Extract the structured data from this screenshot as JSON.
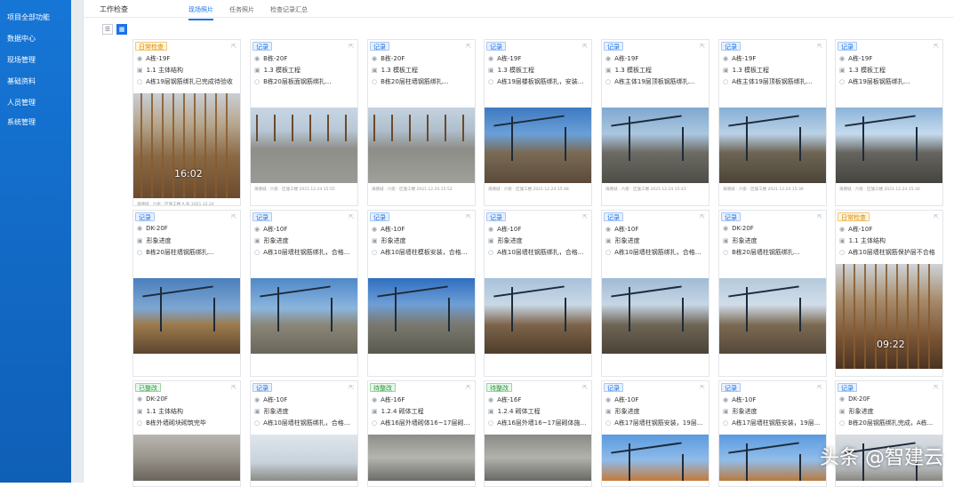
{
  "sidebar": {
    "items": [
      "项目全部功能",
      "数据中心",
      "现场管理",
      "基础资料",
      "人员管理",
      "系统管理"
    ]
  },
  "header": {
    "title": "工作检查",
    "tabs": [
      "现场照片",
      "任务照片",
      "检查记录汇总"
    ]
  },
  "view_toggle": {
    "list_icon": "list-icon",
    "grid_icon": "grid-icon",
    "active": "grid"
  },
  "watermark": "头条 @智建云",
  "cards": [
    {
      "tag": "日常检查",
      "tag_type": "ins",
      "location": "A栋-19F",
      "category": "1.1 主体结构",
      "note": "A栋19层钢筋绑扎已完成待验收",
      "caption": "海德城 · 六街 · 区施工楼 A 栋  2021.12.24",
      "timestamp": "16:02",
      "photo": "rebar"
    },
    {
      "tag": "记录",
      "tag_type": "rec",
      "location": "B栋-20F",
      "category": "1.3 模板工程",
      "note": "B栋20层板面钢筋绑扎...",
      "caption": "海德城 · 六街 · 区施工楼  2021.12.24 15:55",
      "timestamp": "",
      "photo": "deck"
    },
    {
      "tag": "记录",
      "tag_type": "rec",
      "location": "B栋-20F",
      "category": "1.3 模板工程",
      "note": "B栋20层柱墙钢筋绑扎...",
      "caption": "海德城 · 六街 · 区施工楼  2021.12.24 15:52",
      "timestamp": "",
      "photo": "deck2"
    },
    {
      "tag": "记录",
      "tag_type": "rec",
      "location": "A栋-19F",
      "category": "1.3 模板工程",
      "note": "A栋19层楼板钢筋绑扎，安装...",
      "caption": "海德城 · 六街 · 区施工楼  2021.12.24 15:48",
      "timestamp": "",
      "photo": "crane"
    },
    {
      "tag": "记录",
      "tag_type": "rec",
      "location": "A栋-19F",
      "category": "1.3 模板工程",
      "note": "A栋主体19层顶板钢筋绑扎...",
      "caption": "海德城 · 六街 · 区施工楼  2021.12.24 15:41",
      "timestamp": "",
      "photo": "crane2"
    },
    {
      "tag": "记录",
      "tag_type": "rec",
      "location": "A栋-19F",
      "category": "1.3 模板工程",
      "note": "A栋主体19层顶板钢筋绑扎...",
      "caption": "海德城 · 六街 · 区施工楼  2021.12.24 15:36",
      "timestamp": "",
      "photo": "crane3"
    },
    {
      "tag": "记录",
      "tag_type": "rec",
      "location": "A栋-19F",
      "category": "1.3 模板工程",
      "note": "A栋19层板钢筋绑扎...",
      "caption": "海德城 · 六街 · 区施工楼  2021.12.24 15:30",
      "timestamp": "",
      "photo": "crane4"
    },
    {
      "tag": "记录",
      "tag_type": "rec",
      "location": "DK-20F",
      "category": "形象进度",
      "note": "B栋20层柱墙钢筋绑扎...",
      "caption": "",
      "timestamp": "",
      "photo": "site1"
    },
    {
      "tag": "记录",
      "tag_type": "rec",
      "location": "A栋-10F",
      "category": "形象进度",
      "note": "A栋10层墙柱钢筋绑扎，合格...",
      "caption": "",
      "timestamp": "",
      "photo": "site2"
    },
    {
      "tag": "记录",
      "tag_type": "rec",
      "location": "A栋-10F",
      "category": "形象进度",
      "note": "A栋10层墙柱模板安装，合格...",
      "caption": "",
      "timestamp": "",
      "photo": "site3"
    },
    {
      "tag": "记录",
      "tag_type": "rec",
      "location": "A栋-10F",
      "category": "形象进度",
      "note": "A栋10层墙柱钢筋绑扎，合格...",
      "caption": "",
      "timestamp": "",
      "photo": "site4"
    },
    {
      "tag": "记录",
      "tag_type": "rec",
      "location": "A栋-10F",
      "category": "形象进度",
      "note": "A栋10层墙柱钢筋绑扎，合格...",
      "caption": "",
      "timestamp": "",
      "photo": "site5"
    },
    {
      "tag": "记录",
      "tag_type": "rec",
      "location": "DK-20F",
      "category": "形象进度",
      "note": "B栋20层墙柱钢筋绑扎...",
      "caption": "",
      "timestamp": "",
      "photo": "site6"
    },
    {
      "tag": "日常检查",
      "tag_type": "ins",
      "location": "A栋-10F",
      "category": "1.1 主体结构",
      "note": "A栋10层墙柱钢筋保护层不合格",
      "caption": "",
      "timestamp": "09:22",
      "photo": "rebar2"
    },
    {
      "tag": "已整改",
      "tag_type": "fix",
      "location": "DK-20F",
      "category": "1.1 主体结构",
      "note": "B栋外墙砌块砌筑完毕",
      "caption": "",
      "timestamp": "",
      "photo": "wall"
    },
    {
      "tag": "记录",
      "tag_type": "rec",
      "location": "A栋-10F",
      "category": "形象进度",
      "note": "A栋10层墙柱钢筋绑扎，合格...",
      "caption": "",
      "timestamp": "",
      "photo": "sky"
    },
    {
      "tag": "待整改",
      "tag_type": "fix",
      "location": "A栋-16F",
      "category": "1.2.4 砌体工程",
      "note": "A栋16层外墙砌体16~17层砌体施工...",
      "caption": "",
      "timestamp": "",
      "photo": "interior"
    },
    {
      "tag": "待整改",
      "tag_type": "fix",
      "location": "A栋-16F",
      "category": "1.2.4 砌体工程",
      "note": "A栋16层外墙16~17层砌体施工...",
      "caption": "",
      "timestamp": "",
      "photo": "interior2"
    },
    {
      "tag": "记录",
      "tag_type": "rec",
      "location": "A栋-10F",
      "category": "形象进度",
      "note": "A栋17层墙柱钢筋安装，19层...",
      "caption": "",
      "timestamp": "",
      "photo": "city"
    },
    {
      "tag": "记录",
      "tag_type": "rec",
      "location": "A栋-10F",
      "category": "形象进度",
      "note": "A栋17层墙柱钢筋安装，19层...",
      "caption": "",
      "timestamp": "",
      "photo": "city2"
    },
    {
      "tag": "记录",
      "tag_type": "rec",
      "location": "DK-20F",
      "category": "形象进度",
      "note": "B栋20层钢筋绑扎完成，A栋...",
      "caption": "",
      "timestamp": "",
      "photo": "city3"
    }
  ]
}
